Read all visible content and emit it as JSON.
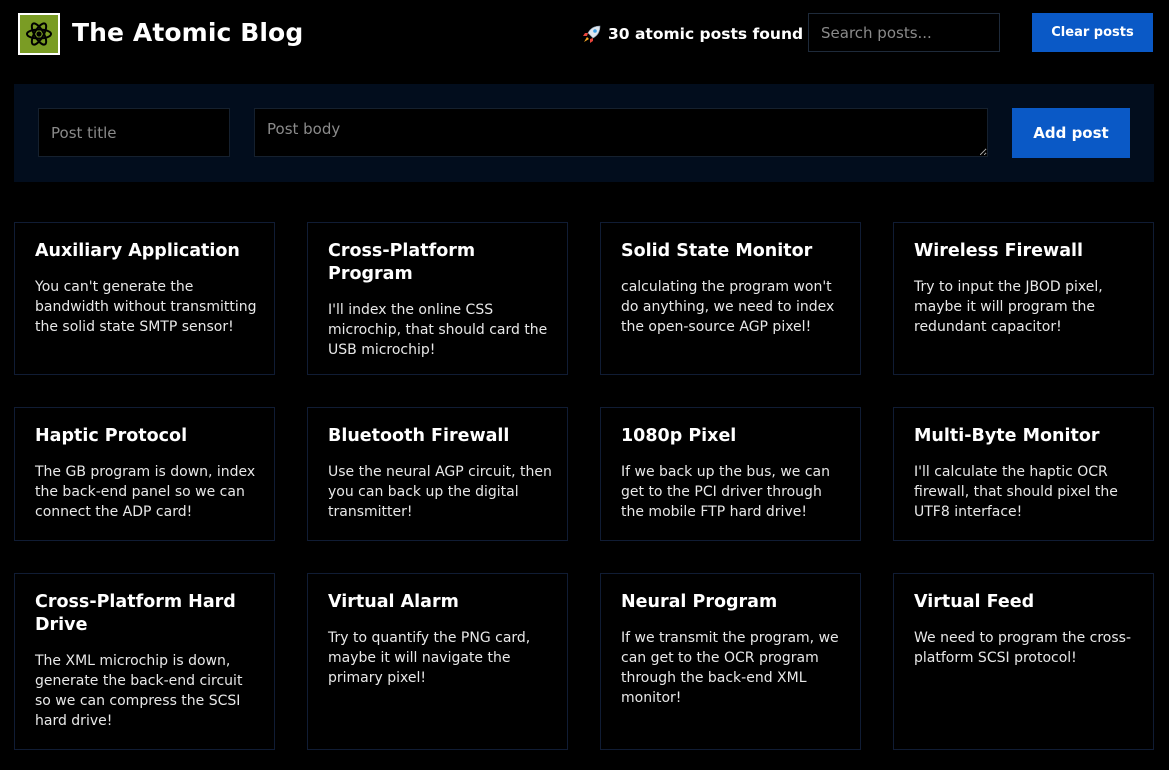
{
  "header": {
    "title": "The Atomic Blog",
    "logo_icon": "atom-icon",
    "logo_color": "#7a9c24",
    "posts_count_text": "30 atomic posts found",
    "posts_count_icon": "rocket-icon",
    "search_placeholder": "Search posts...",
    "search_value": "",
    "clear_label": "Clear posts"
  },
  "form": {
    "title_placeholder": "Post title",
    "title_value": "",
    "body_placeholder": "Post body",
    "body_value": "",
    "add_label": "Add post"
  },
  "colors": {
    "background": "#000000",
    "accent": "#0a59c6",
    "panel": "#020d1d",
    "card_border": "#101c34"
  },
  "posts": [
    {
      "title": "Auxiliary Application",
      "body": "You can't generate the bandwidth without transmitting the solid state SMTP sensor!"
    },
    {
      "title": "Cross-Platform Program",
      "body": "I'll index the online CSS microchip, that should card the USB microchip!"
    },
    {
      "title": "Solid State Monitor",
      "body": "calculating the program won't do anything, we need to index the open-source AGP pixel!"
    },
    {
      "title": "Wireless Firewall",
      "body": "Try to input the JBOD pixel, maybe it will program the redundant capacitor!"
    },
    {
      "title": "Haptic Protocol",
      "body": "The GB program is down, index the back-end panel so we can connect the ADP card!"
    },
    {
      "title": "Bluetooth Firewall",
      "body": "Use the neural AGP circuit, then you can back up the digital transmitter!"
    },
    {
      "title": "1080p Pixel",
      "body": "If we back up the bus, we can get to the PCI driver through the mobile FTP hard drive!"
    },
    {
      "title": "Multi-Byte Monitor",
      "body": "I'll calculate the haptic OCR firewall, that should pixel the UTF8 interface!"
    },
    {
      "title": "Cross-Platform Hard Drive",
      "body": "The XML microchip is down, generate the back-end circuit so we can compress the SCSI hard drive!"
    },
    {
      "title": "Virtual Alarm",
      "body": "Try to quantify the PNG card, maybe it will navigate the primary pixel!"
    },
    {
      "title": "Neural Program",
      "body": "If we transmit the program, we can get to the OCR program through the back-end XML monitor!"
    },
    {
      "title": "Virtual Feed",
      "body": "We need to program the cross-platform SCSI protocol!"
    }
  ]
}
